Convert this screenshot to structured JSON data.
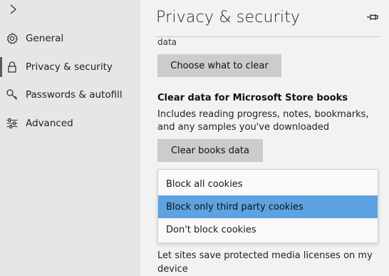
{
  "sidebar": {
    "items": [
      {
        "label": "General",
        "icon": "gear-icon"
      },
      {
        "label": "Privacy & security",
        "icon": "lock-icon",
        "active": true
      },
      {
        "label": "Passwords & autofill",
        "icon": "key-icon"
      },
      {
        "label": "Advanced",
        "icon": "sliders-icon"
      }
    ]
  },
  "header": {
    "title": "Privacy & security"
  },
  "main": {
    "clipped_text": "data",
    "choose_button": "Choose what to clear",
    "books_section": {
      "heading": "Clear data for Microsoft Store books",
      "description": "Includes reading progress, notes, bookmarks, and any samples you've downloaded",
      "button": "Clear books data"
    },
    "cookies_dropdown": {
      "options": [
        "Block all cookies",
        "Block only third party cookies",
        "Don't block cookies"
      ],
      "selected": "Block only third party cookies"
    },
    "licenses_text": "Let sites save protected media licenses on my device"
  },
  "colors": {
    "selected_option": "#5da3e1",
    "sidebar_bg": "#e6e6e6",
    "content_bg": "#f2f2f2",
    "button_bg": "#cccccc"
  }
}
